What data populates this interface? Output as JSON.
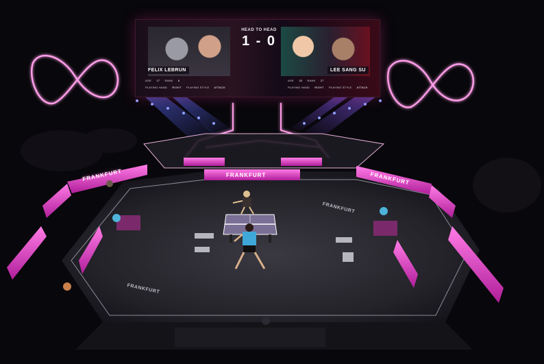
{
  "scoreboard": {
    "heading": "HEAD TO HEAD",
    "score": "1 - 0",
    "left_player": {
      "name": "FELIX LEBRUN",
      "age_label": "AGE",
      "age": "17",
      "rank_label": "RANK",
      "rank": "8",
      "hand_label": "PLAYING HAND",
      "hand": "RIGHT",
      "style_label": "PLAYING STYLE",
      "style": "ATTACK"
    },
    "right_player": {
      "name": "LEE SANG SU",
      "age_label": "AGE",
      "age": "33",
      "rank_label": "RANK",
      "rank": "27",
      "hand_label": "PLAYING HAND",
      "hand": "RIGHT",
      "style_label": "PLAYING STYLE",
      "style": "ATTACK"
    }
  },
  "boards": {
    "left": "FRANKFURT",
    "right": "FRANKFURT",
    "center": "FRANKFURT"
  },
  "floor": {
    "text_left": "FRANKFURT",
    "text_right": "FRANKFURT"
  },
  "colors": {
    "neon": "#ff4fd8",
    "court": "#2b2a31",
    "table": "#7a6f95"
  }
}
